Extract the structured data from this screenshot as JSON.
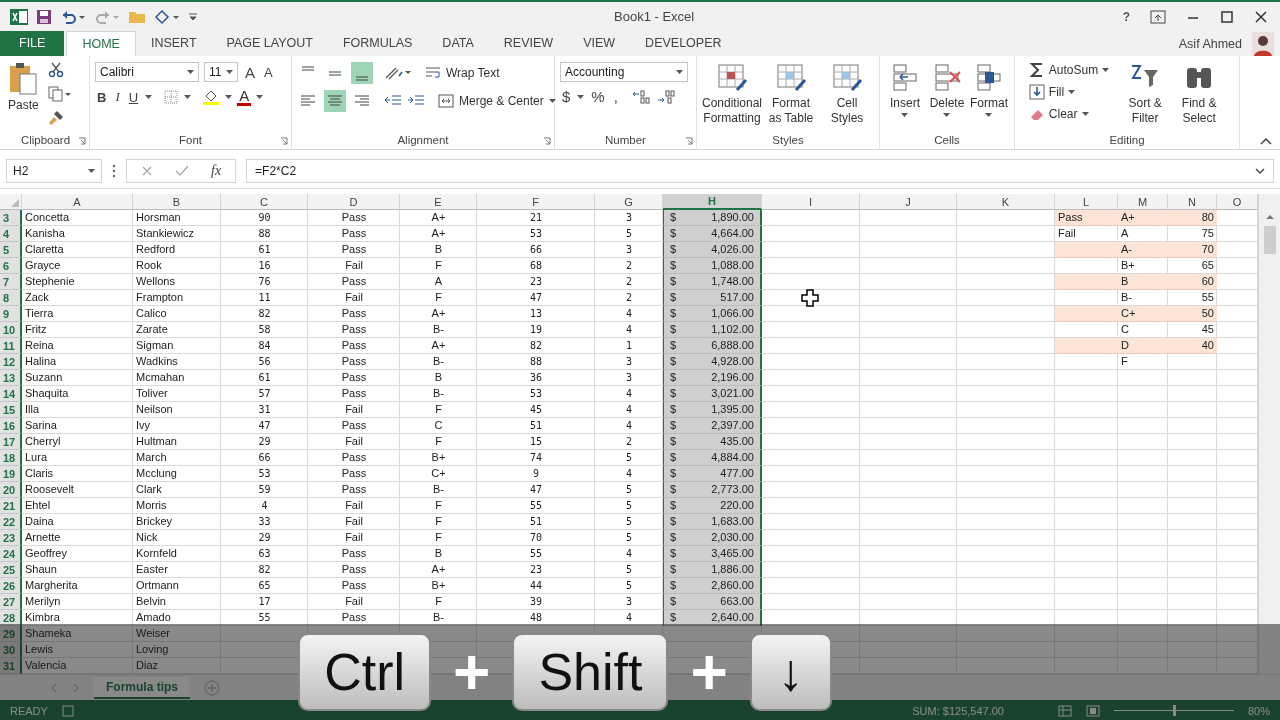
{
  "window": {
    "title": "Book1 - Excel",
    "user": "Asif Ahmed",
    "help": "?"
  },
  "ribbon_tabs": [
    {
      "label": "FILE",
      "kind": "file",
      "selected": false
    },
    {
      "label": "HOME",
      "kind": "tab",
      "selected": true
    },
    {
      "label": "INSERT",
      "kind": "tab",
      "selected": false
    },
    {
      "label": "PAGE LAYOUT",
      "kind": "tab",
      "selected": false
    },
    {
      "label": "FORMULAS",
      "kind": "tab",
      "selected": false
    },
    {
      "label": "DATA",
      "kind": "tab",
      "selected": false
    },
    {
      "label": "REVIEW",
      "kind": "tab",
      "selected": false
    },
    {
      "label": "VIEW",
      "kind": "tab",
      "selected": false
    },
    {
      "label": "DEVELOPER",
      "kind": "tab",
      "selected": false
    }
  ],
  "clipboard": {
    "paste": "Paste",
    "label": "Clipboard"
  },
  "font": {
    "name": "Calibri",
    "size": "11",
    "grow": "A",
    "shrink": "A",
    "bold": "B",
    "italic": "I",
    "underline": "U",
    "color_letter": "A",
    "label": "Font"
  },
  "alignment": {
    "vertical": [
      {
        "selected": false
      },
      {
        "selected": false
      },
      {
        "selected": true
      }
    ],
    "horizontal": [
      {
        "selected": false
      },
      {
        "selected": true
      },
      {
        "selected": false
      }
    ],
    "wrap": "Wrap Text",
    "merge": "Merge & Center",
    "label": "Alignment"
  },
  "number": {
    "format": "Accounting",
    "currency": "$",
    "percent": "%",
    "comma": ",",
    "label": "Number"
  },
  "styles": {
    "buttons": [
      "Conditional Formatting",
      "Format as Table",
      "Cell Styles"
    ],
    "label": "Styles"
  },
  "cells": {
    "buttons": [
      "Insert",
      "Delete",
      "Format"
    ],
    "label": "Cells"
  },
  "editing": {
    "autosum": "AutoSum",
    "fill": "Fill",
    "clear": "Clear",
    "sort": "Sort & Filter",
    "find": "Find & Select",
    "label": "Editing"
  },
  "formula_bar": {
    "name_box": "H2",
    "fx": "fx",
    "formula": "=F2*C2"
  },
  "sheet": {
    "columns": [
      {
        "label": "A",
        "selected": false
      },
      {
        "label": "B",
        "selected": false
      },
      {
        "label": "C",
        "selected": false
      },
      {
        "label": "D",
        "selected": false
      },
      {
        "label": "E",
        "selected": false
      },
      {
        "label": "F",
        "selected": false
      },
      {
        "label": "G",
        "selected": false
      },
      {
        "label": "H",
        "selected": true
      },
      {
        "label": "I",
        "selected": false
      },
      {
        "label": "J",
        "selected": false
      },
      {
        "label": "K",
        "selected": false
      },
      {
        "label": "L",
        "selected": false
      },
      {
        "label": "M",
        "selected": false
      },
      {
        "label": "N",
        "selected": false
      },
      {
        "label": "O",
        "selected": false
      }
    ],
    "rows": [
      {
        "row": "3",
        "A": "Concetta",
        "B": "Horsman",
        "C": "90",
        "D": "Pass",
        "E": "A+",
        "F": "21",
        "G": "3",
        "H_symbol": "$",
        "H": "1,890.00",
        "L": "Pass",
        "M": "A+",
        "N": "80",
        "shaded": true
      },
      {
        "row": "4",
        "A": "Kanisha",
        "B": "Stankiewicz",
        "C": "88",
        "D": "Pass",
        "E": "A+",
        "F": "53",
        "G": "5",
        "H_symbol": "$",
        "H": "4,664.00",
        "L": "Fail",
        "M": "A",
        "N": "75",
        "shaded": false
      },
      {
        "row": "5",
        "A": "Claretta",
        "B": "Redford",
        "C": "61",
        "D": "Pass",
        "E": "B",
        "F": "66",
        "G": "3",
        "H_symbol": "$",
        "H": "4,026.00",
        "M": "A-",
        "N": "70",
        "shaded": true
      },
      {
        "row": "6",
        "A": "Grayce",
        "B": "Rook",
        "C": "16",
        "D": "Fail",
        "E": "F",
        "F": "68",
        "G": "2",
        "H_symbol": "$",
        "H": "1,088.00",
        "M": "B+",
        "N": "65",
        "shaded": false
      },
      {
        "row": "7",
        "A": "Stephenie",
        "B": "Wellons",
        "C": "76",
        "D": "Pass",
        "E": "A",
        "F": "23",
        "G": "2",
        "H_symbol": "$",
        "H": "1,748.00",
        "M": "B",
        "N": "60",
        "shaded": true
      },
      {
        "row": "8",
        "A": "Zack",
        "B": "Frampton",
        "C": "11",
        "D": "Fail",
        "E": "F",
        "F": "47",
        "G": "2",
        "H_symbol": "$",
        "H": "517.00",
        "M": "B-",
        "N": "55",
        "shaded": false
      },
      {
        "row": "9",
        "A": "Tierra",
        "B": "Calico",
        "C": "82",
        "D": "Pass",
        "E": "A+",
        "F": "13",
        "G": "4",
        "H_symbol": "$",
        "H": "1,066.00",
        "M": "C+",
        "N": "50",
        "shaded": true
      },
      {
        "row": "10",
        "A": "Fritz",
        "B": "Zarate",
        "C": "58",
        "D": "Pass",
        "E": "B-",
        "F": "19",
        "G": "4",
        "H_symbol": "$",
        "H": "1,102.00",
        "M": "C",
        "N": "45",
        "shaded": false
      },
      {
        "row": "11",
        "A": "Reina",
        "B": "Sigman",
        "C": "84",
        "D": "Pass",
        "E": "A+",
        "F": "82",
        "G": "1",
        "H_symbol": "$",
        "H": "6,888.00",
        "M": "D",
        "N": "40",
        "shaded": true
      },
      {
        "row": "12",
        "A": "Halina",
        "B": "Wadkins",
        "C": "56",
        "D": "Pass",
        "E": "B-",
        "F": "88",
        "G": "3",
        "H_symbol": "$",
        "H": "4,928.00",
        "M": "F",
        "shaded": false
      },
      {
        "row": "13",
        "A": "Suzann",
        "B": "Mcmahan",
        "C": "61",
        "D": "Pass",
        "E": "B",
        "F": "36",
        "G": "3",
        "H_symbol": "$",
        "H": "2,196.00"
      },
      {
        "row": "14",
        "A": "Shaquita",
        "B": "Toliver",
        "C": "57",
        "D": "Pass",
        "E": "B-",
        "F": "53",
        "G": "4",
        "H_symbol": "$",
        "H": "3,021.00"
      },
      {
        "row": "15",
        "A": "Illa",
        "B": "Neilson",
        "C": "31",
        "D": "Fail",
        "E": "F",
        "F": "45",
        "G": "4",
        "H_symbol": "$",
        "H": "1,395.00"
      },
      {
        "row": "16",
        "A": "Sarina",
        "B": "Ivy",
        "C": "47",
        "D": "Pass",
        "E": "C",
        "F": "51",
        "G": "4",
        "H_symbol": "$",
        "H": "2,397.00"
      },
      {
        "row": "17",
        "A": "Cherryl",
        "B": "Hultman",
        "C": "29",
        "D": "Fail",
        "E": "F",
        "F": "15",
        "G": "2",
        "H_symbol": "$",
        "H": "435.00"
      },
      {
        "row": "18",
        "A": "Lura",
        "B": "March",
        "C": "66",
        "D": "Pass",
        "E": "B+",
        "F": "74",
        "G": "5",
        "H_symbol": "$",
        "H": "4,884.00"
      },
      {
        "row": "19",
        "A": "Claris",
        "B": "Mcclung",
        "C": "53",
        "D": "Pass",
        "E": "C+",
        "F": "9",
        "G": "4",
        "H_symbol": "$",
        "H": "477.00"
      },
      {
        "row": "20",
        "A": "Roosevelt",
        "B": "Clark",
        "C": "59",
        "D": "Pass",
        "E": "B-",
        "F": "47",
        "G": "5",
        "H_symbol": "$",
        "H": "2,773.00"
      },
      {
        "row": "21",
        "A": "Ehtel",
        "B": "Morris",
        "C": "4",
        "D": "Fail",
        "E": "F",
        "F": "55",
        "G": "5",
        "H_symbol": "$",
        "H": "220.00"
      },
      {
        "row": "22",
        "A": "Daina",
        "B": "Brickey",
        "C": "33",
        "D": "Fail",
        "E": "F",
        "F": "51",
        "G": "5",
        "H_symbol": "$",
        "H": "1,683.00"
      },
      {
        "row": "23",
        "A": "Arnette",
        "B": "Nick",
        "C": "29",
        "D": "Fail",
        "E": "F",
        "F": "70",
        "G": "5",
        "H_symbol": "$",
        "H": "2,030.00"
      },
      {
        "row": "24",
        "A": "Geoffrey",
        "B": "Kornfeld",
        "C": "63",
        "D": "Pass",
        "E": "B",
        "F": "55",
        "G": "4",
        "H_symbol": "$",
        "H": "3,465.00"
      },
      {
        "row": "25",
        "A": "Shaun",
        "B": "Easter",
        "C": "82",
        "D": "Pass",
        "E": "A+",
        "F": "23",
        "G": "5",
        "H_symbol": "$",
        "H": "1,886.00"
      },
      {
        "row": "26",
        "A": "Margherita",
        "B": "Ortmann",
        "C": "65",
        "D": "Pass",
        "E": "B+",
        "F": "44",
        "G": "5",
        "H_symbol": "$",
        "H": "2,860.00"
      },
      {
        "row": "27",
        "A": "Merilyn",
        "B": "Belvin",
        "C": "17",
        "D": "Fail",
        "E": "F",
        "F": "39",
        "G": "3",
        "H_symbol": "$",
        "H": "663.00"
      },
      {
        "row": "28",
        "A": "Kimbra",
        "B": "Amado",
        "C": "55",
        "D": "Pass",
        "E": "B-",
        "F": "48",
        "G": "4",
        "H_symbol": "$",
        "H": "2,640.00"
      },
      {
        "row": "29",
        "A": "Shameka",
        "B": "Weiser"
      },
      {
        "row": "30",
        "A": "Lewis",
        "B": "Loving"
      },
      {
        "row": "31",
        "A": "Valencia",
        "B": "Diaz"
      }
    ]
  },
  "sheet_tabs": [
    {
      "label": "Formula tips",
      "selected": true
    }
  ],
  "status_bar": {
    "mode": "READY",
    "sum": "SUM: $125,547.00",
    "zoom_slider": {
      "level": 0.5
    },
    "zoom": "80%"
  },
  "keystroke_overlay": [
    {
      "kind": "key",
      "label": "Ctrl"
    },
    {
      "kind": "plus",
      "label": "+"
    },
    {
      "kind": "key",
      "label": "Shift"
    },
    {
      "kind": "plus",
      "label": "+"
    },
    {
      "kind": "key",
      "label": "↓"
    }
  ]
}
